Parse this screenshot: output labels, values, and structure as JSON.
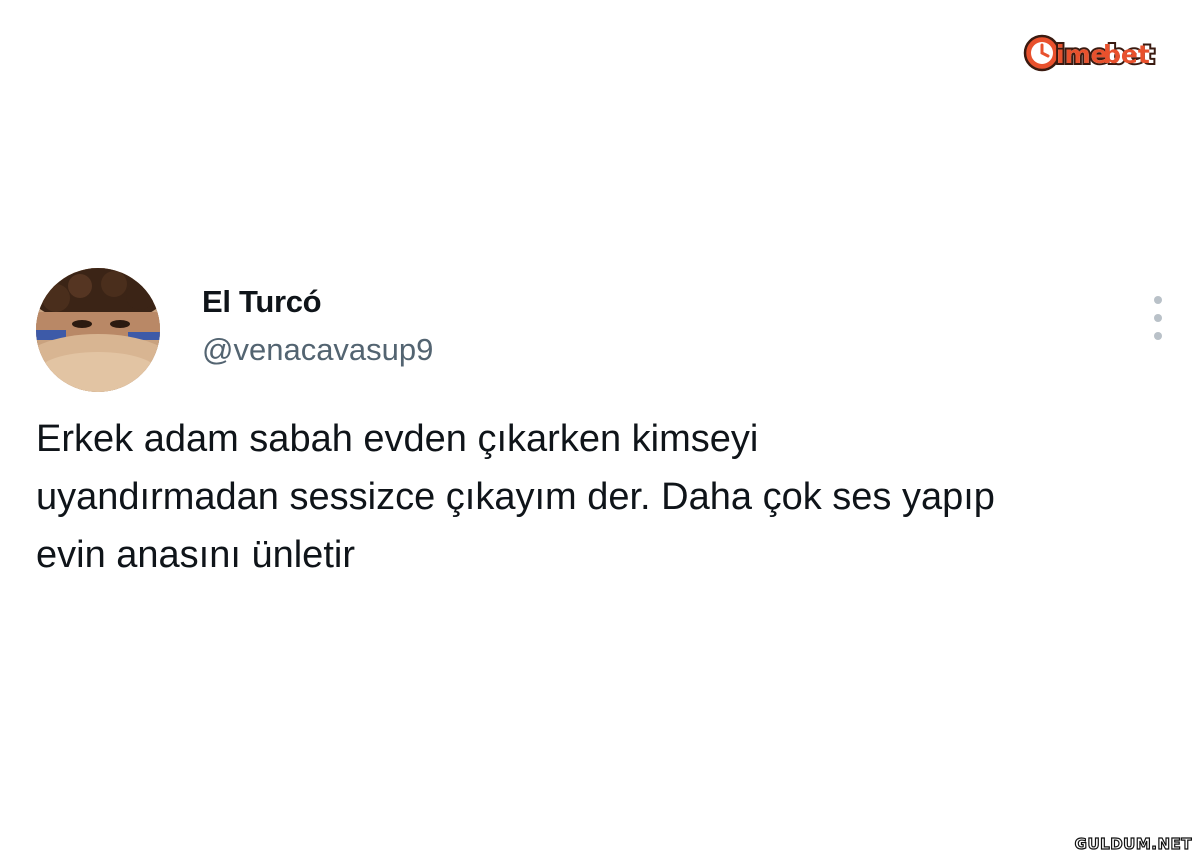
{
  "watermarks": {
    "brand": "timebet",
    "brand_color": "#e8512d",
    "site": "GULDUM.NET"
  },
  "tweet": {
    "author": {
      "display_name": "El Turcó",
      "handle": "@venacavasup9",
      "avatar_icon": "profile-photo"
    },
    "more_icon": "vertical-ellipsis-icon",
    "text_lines": [
      "Erkek adam sabah evden çıkarken kimseyi",
      "uyandırmadan sessizce çıkayım der. Daha çok ses yapıp",
      "evin anasını ünletir"
    ]
  },
  "colors": {
    "text_primary": "#0f1419",
    "text_secondary": "#536471",
    "icon_muted": "#b9c1c8",
    "background": "#ffffff"
  }
}
